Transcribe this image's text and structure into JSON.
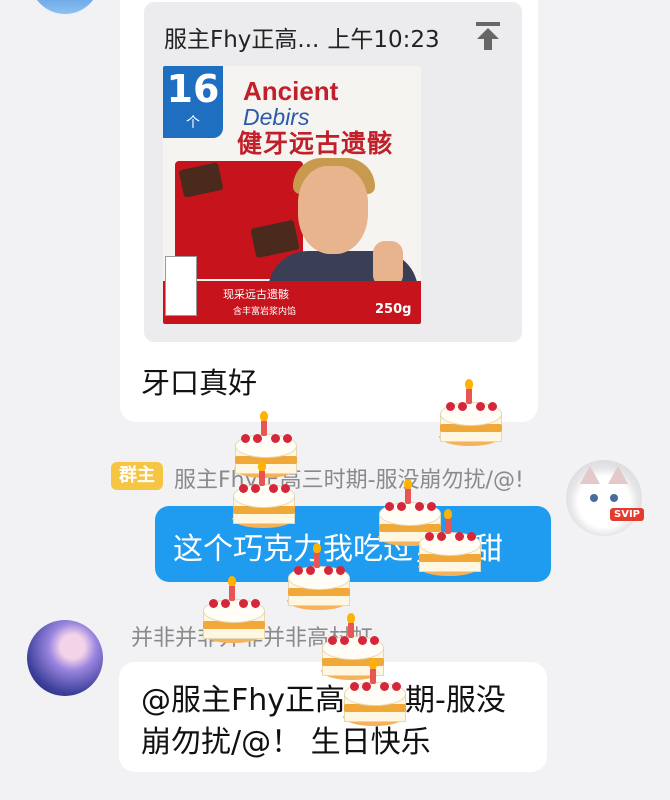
{
  "messages": [
    {
      "quote": {
        "sender": "服主Fhy正高...",
        "time": "上午10:23",
        "image": {
          "badge_number": "16",
          "badge_unit": "个",
          "brand_line1": "Ancient",
          "brand_line2": "Debirs",
          "brand_cn": "健牙远古遗骸",
          "band_text1": "现采远古遗骸",
          "band_text2": "含丰富岩浆内馅",
          "weight": "250g"
        }
      },
      "text": "牙口真好"
    },
    {
      "badge": "群主",
      "sender": "服主Fhy正高三时期-服没崩勿扰/@!",
      "text": "这个巧克力我吃过，齁甜",
      "avatar_badge": "SVIP"
    },
    {
      "sender": "并非并非并非并非高村虹",
      "text": "@服主Fhy正高三时期-服没崩勿扰/@！ 生日快乐"
    }
  ],
  "icons": {
    "pin": "pin-to-top-icon",
    "cake": "birthday-cake-icon"
  },
  "colors": {
    "bubble_blue": "#1f9bf0",
    "owner_badge": "#f6c544",
    "background": "#f2f2f4"
  }
}
